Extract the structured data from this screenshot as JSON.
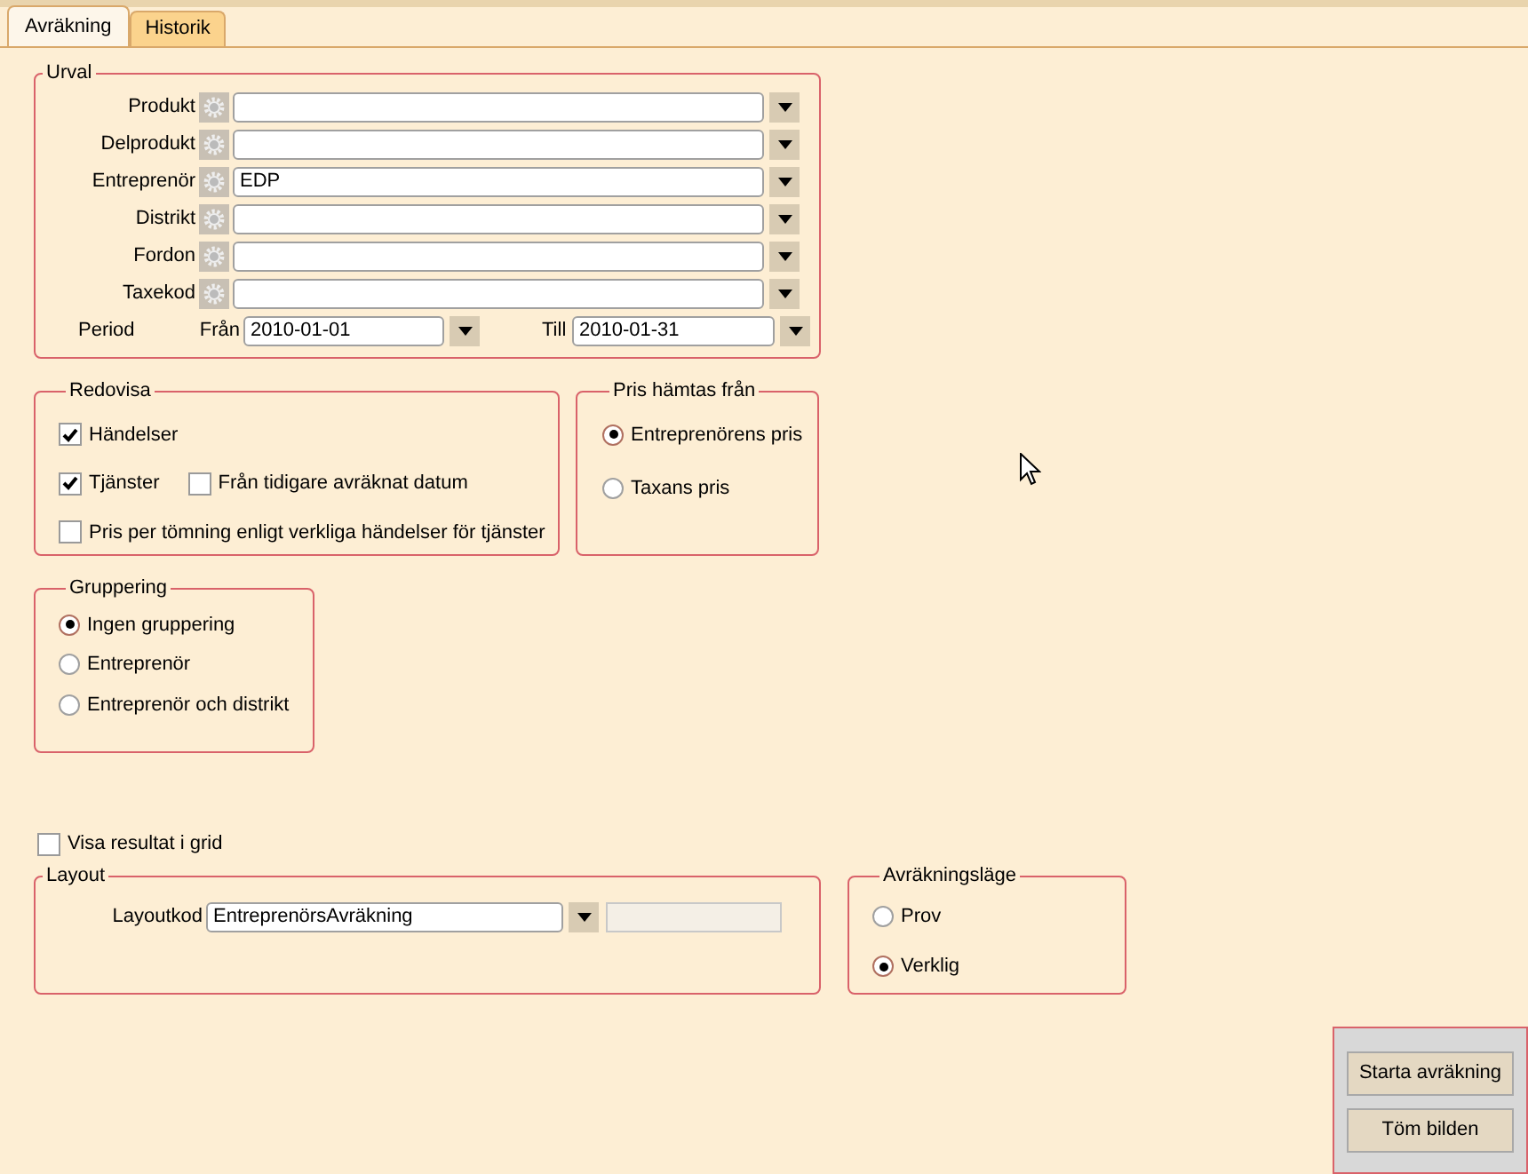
{
  "tabs": [
    {
      "label": "Avräkning",
      "selected": true
    },
    {
      "label": "Historik",
      "selected": false
    }
  ],
  "urval": {
    "title": "Urval",
    "fields": [
      {
        "label": "Produkt"
      },
      {
        "label": "Delprodukt"
      },
      {
        "label": "Entreprenör",
        "value": "EDP"
      },
      {
        "label": "Distrikt"
      },
      {
        "label": "Fordon"
      },
      {
        "label": "Taxekod"
      }
    ],
    "period": {
      "label": "Period",
      "from_label": "Från",
      "from_value": "2010-01-01",
      "to_label": "Till",
      "to_value": "2010-01-31"
    }
  },
  "redovisa": {
    "title": "Redovisa",
    "rows": [
      [
        {
          "label": "Händelser",
          "checked": true
        }
      ],
      [
        {
          "label": "Tjänster",
          "checked": true
        },
        {
          "label": "Från tidigare avräknat datum",
          "checked": false
        }
      ],
      [
        {
          "label": "Pris per tömning enligt verkliga händelser för tjänster",
          "checked": false
        }
      ]
    ]
  },
  "pris_hamtas_fran": {
    "title": "Pris hämtas från",
    "options": [
      {
        "label": "Entreprenörens pris",
        "selected": true
      },
      {
        "label": "Taxans pris",
        "selected": false
      }
    ]
  },
  "gruppering": {
    "title": "Gruppering",
    "options": [
      {
        "label": "Ingen gruppering",
        "selected": true
      },
      {
        "label": "Entreprenör",
        "selected": false
      },
      {
        "label": "Entreprenör och distrikt",
        "selected": false
      }
    ]
  },
  "visa_resultat": {
    "label": "Visa resultat i grid",
    "checked": false
  },
  "layout": {
    "title": "Layout",
    "label": "Layoutkod",
    "value": "EntreprenörsAvräkning"
  },
  "avrakningslage": {
    "title": "Avräkningsläge",
    "options": [
      {
        "label": "Prov",
        "selected": false
      },
      {
        "label": "Verklig",
        "selected": true
      }
    ]
  },
  "buttons": [
    "Starta avräkning",
    "Töm bilden"
  ]
}
